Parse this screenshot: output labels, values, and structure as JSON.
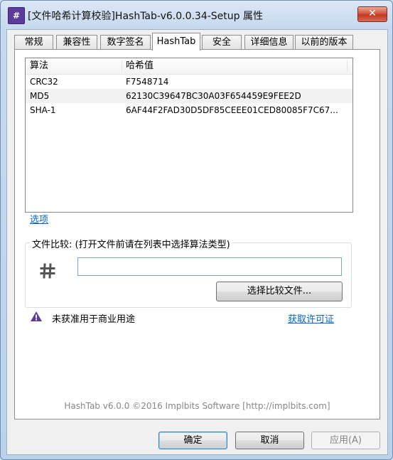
{
  "window": {
    "title": "[文件哈希计算校验]HashTab-v6.0.0.34-Setup 属性",
    "icon_name": "hashtab-app-icon",
    "close_label": "✕"
  },
  "tabs": [
    {
      "label": "常规"
    },
    {
      "label": "兼容性"
    },
    {
      "label": "数字签名"
    },
    {
      "label": "HashTab",
      "active": true
    },
    {
      "label": "安全"
    },
    {
      "label": "详细信息"
    },
    {
      "label": "以前的版本"
    }
  ],
  "hash_list": {
    "columns": [
      "算法",
      "哈希值"
    ],
    "rows": [
      {
        "algorithm": "CRC32",
        "value": "F7548714"
      },
      {
        "algorithm": "MD5",
        "value": "62130C39647BC30A03F654459E9FEE2D"
      },
      {
        "algorithm": "SHA-1",
        "value": "6AF44F2FAD30D5DF85CEEE01CED80085F7C67..."
      }
    ]
  },
  "options_link": "选项",
  "compare": {
    "group_label": "文件比较: (打开文件前请在列表中选择算法类型)",
    "input_value": "",
    "select_button": "选择比较文件..."
  },
  "license": {
    "warning": "未获准用于商业用途",
    "get_license_link": "获取许可证"
  },
  "footer": "HashTab v6.0.0 ©2016 Implbits Software [http://implbits.com]",
  "buttons": {
    "ok": "确定",
    "cancel": "取消",
    "apply": "应用(A)"
  },
  "colors": {
    "link": "#0066cc",
    "warning_icon": "#5d3a9b",
    "close_button": "#c43a22"
  }
}
